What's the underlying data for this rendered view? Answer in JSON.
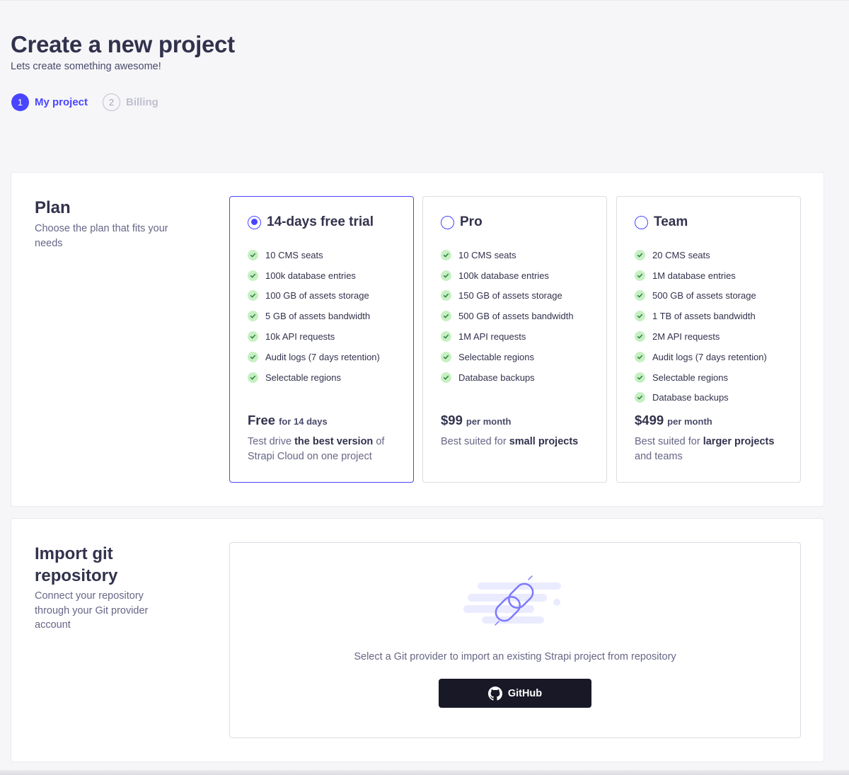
{
  "header": {
    "title": "Create a new project",
    "subtitle": "Lets create something awesome!"
  },
  "stepper": {
    "steps": [
      {
        "number": "1",
        "label": "My project",
        "active": true
      },
      {
        "number": "2",
        "label": "Billing",
        "active": false
      }
    ]
  },
  "plan_section": {
    "title": "Plan",
    "description": "Choose the plan that fits your needs",
    "plans": [
      {
        "name": "14-days free trial",
        "selected": true,
        "features": [
          "10 CMS seats",
          "100k database entries",
          "100 GB of assets storage",
          "5 GB of assets bandwidth",
          "10k API requests",
          "Audit logs (7 days retention)",
          "Selectable regions"
        ],
        "price": "Free",
        "price_unit": "for 14 days",
        "desc_pre": "Test drive ",
        "desc_bold": "the best version",
        "desc_post": " of Strapi Cloud on one project"
      },
      {
        "name": "Pro",
        "selected": false,
        "features": [
          "10 CMS seats",
          "100k database entries",
          "150 GB of assets storage",
          "500 GB of assets bandwidth",
          "1M API requests",
          "Selectable regions",
          "Database backups"
        ],
        "price": "$99",
        "price_unit": "per month",
        "desc_pre": "Best suited for ",
        "desc_bold": "small projects",
        "desc_post": ""
      },
      {
        "name": "Team",
        "selected": false,
        "features": [
          "20 CMS seats",
          "1M database entries",
          "500 GB of assets storage",
          "1 TB of assets bandwidth",
          "2M API requests",
          "Audit logs (7 days retention)",
          "Selectable regions",
          "Database backups"
        ],
        "price": "$499",
        "price_unit": "per month",
        "desc_pre": "Best suited for ",
        "desc_bold": "larger projects",
        "desc_post": " and teams"
      }
    ]
  },
  "git_section": {
    "title": "Import git repository",
    "description": "Connect your repository through your Git provider account",
    "illustration_icon": "link-chain-icon",
    "prompt": "Select a Git provider to import an existing Strapi project from repository",
    "github_button": {
      "label": "GitHub",
      "icon": "github-icon"
    }
  },
  "colors": {
    "primary": "#4945ff",
    "page_bg": "#f6f6f9",
    "success_bg": "#c6f0c2",
    "success_check": "#328048",
    "button_dark": "#181826",
    "illustration_light": "#ebebff",
    "illustration_stroke": "#7b79ff"
  }
}
